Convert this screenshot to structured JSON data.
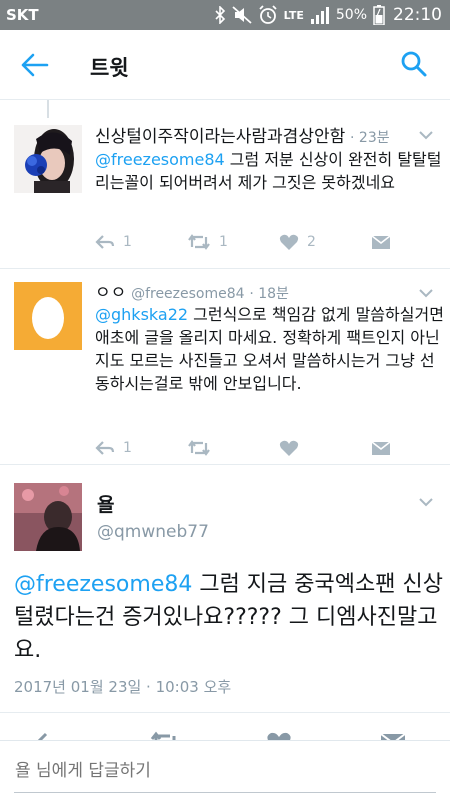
{
  "status_bar": {
    "carrier": "SKT",
    "network": "LTE",
    "battery_percent": "50%",
    "time": "22:10",
    "icons": [
      "bluetooth-icon",
      "mute-icon",
      "alarm-icon",
      "signal-icon",
      "battery-icon"
    ]
  },
  "app_bar": {
    "title": "트윗",
    "back_icon": "arrow-left-icon",
    "search_icon": "search-icon"
  },
  "tweets": [
    {
      "name": "신상털이주작이라는사람과겸상안함",
      "time": "· 23분",
      "mention": "@freezesome84",
      "text": " 그럼 저분 신상이 완전히 탈탈털리는꼴이 되어버려서 제가 그짓은 못하겠네요",
      "reply_count": "1",
      "retweet_count": "1",
      "like_count": "2"
    },
    {
      "name": "ㅇㅇ",
      "handle": "@freezesome84",
      "time": "· 18분",
      "mention": "@ghkska22",
      "text": " 그런식으로 책임감 없게 말씀하실거면 애초에 글을 올리지 마세요. 정확하게 팩트인지 아닌지도 모르는 사진들고 오셔서 말씀하시는거 그냥 선동하시는걸로 밖에 안보입니다.",
      "reply_count": "1"
    }
  ],
  "focused_tweet": {
    "name": "욜",
    "handle": "@qmwneb77",
    "mention": "@freezesome84",
    "text": " 그럼 지금 중국엑소팬 신상털렸다는건 증거있나요?????  그 디엠사진말고요.",
    "date": "2017년 01월 23일 · 10:03 오후"
  },
  "reply_bar": {
    "placeholder": "욜 님에게 답글하기"
  },
  "colors": {
    "accent": "#1da1f2",
    "status_bar": "#7b8183",
    "muted": "#8899a6",
    "icon_muted": "#aab8c2"
  }
}
